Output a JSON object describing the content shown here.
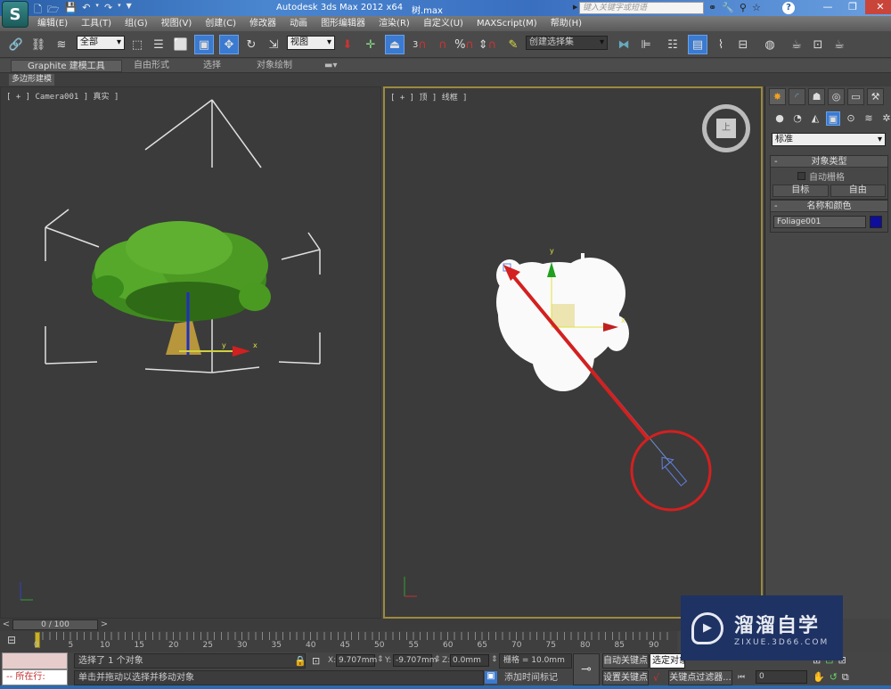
{
  "window": {
    "app_title": "Autodesk 3ds Max  2012 x64",
    "file_name": "树.max",
    "search_placeholder": "键入关键字或短语",
    "app_logo": "3ds-max-logo",
    "quick_access": [
      "new-icon",
      "open-icon",
      "save-icon",
      "undo-icon",
      "redo-icon",
      "customize-dropdown-icon"
    ],
    "win_controls": {
      "minimize": "—",
      "maximize": "❐",
      "close": "✕"
    },
    "help_label": "?"
  },
  "menu": [
    "编辑(E)",
    "工具(T)",
    "组(G)",
    "视图(V)",
    "创建(C)",
    "修改器",
    "动画",
    "图形编辑器",
    "渲染(R)",
    "自定义(U)",
    "MAXScript(M)",
    "帮助(H)"
  ],
  "toolbar": {
    "selection_filter": "全部",
    "reference_coord": "视图",
    "named_selection_set": "创建选择集",
    "snap_value": "3"
  },
  "ribbon": {
    "tabs": [
      "Graphite 建模工具",
      "自由形式",
      "选择",
      "对象绘制"
    ],
    "active_tab": "Graphite 建模工具",
    "sub_tab": "多边形建模"
  },
  "viewports": {
    "left_label": "[ + ] Camera001 ] 真实 ]",
    "right_label": "[ + ] 顶 ] 线框 ]",
    "viewcube_face": "上",
    "gizmo_labels": {
      "x": "x",
      "y": "y"
    }
  },
  "command_panel": {
    "tabs": [
      "create-icon",
      "modify-icon",
      "hierarchy-icon",
      "motion-icon",
      "display-icon",
      "utilities-icon"
    ],
    "categories": [
      "geometry-icon",
      "shapes-icon",
      "lights-icon",
      "cameras-icon",
      "helpers-icon",
      "spacewarps-icon",
      "systems-icon"
    ],
    "type_select": "标准",
    "object_type": {
      "title": "对象类型",
      "autogrid_label": "自动栅格",
      "autogrid_checked": false,
      "buttons": [
        "目标",
        "自由"
      ]
    },
    "name_color": {
      "title": "名称和颜色",
      "name": "Foliage001",
      "color": "#0e0e9a"
    }
  },
  "timeline": {
    "slider_label": "0 / 100",
    "current_frame": 0,
    "total_frames": 100,
    "ticks": [
      "0",
      "5",
      "10",
      "15",
      "20",
      "25",
      "30",
      "35",
      "40",
      "45",
      "50",
      "55",
      "60",
      "65",
      "70",
      "75",
      "80",
      "85",
      "90"
    ]
  },
  "status": {
    "maxscript_line": "-- 所在行:",
    "selected_text": "选择了 1 个对象",
    "prompt_text": "单击并拖动以选择并移动对象",
    "x_label": "X:",
    "x_value": "9.707mm",
    "y_label": "Y:",
    "y_value": "-9.707mm",
    "z_label": "Z:",
    "z_value": "0.0mm",
    "grid_text": "栅格 = 10.0mm",
    "add_time_tag": "添加时间标记",
    "auto_key": "自动关键点",
    "set_key": "设置关键点",
    "selection_set": "选定对象",
    "key_filters": "关键点过滤器...",
    "frame_value": "0"
  },
  "watermark": {
    "title": "溜溜自学",
    "subtitle": "ZIXUE.3D66.COM"
  },
  "annotations": {
    "arrow_color": "#d42020",
    "circle_color": "#d42020"
  }
}
